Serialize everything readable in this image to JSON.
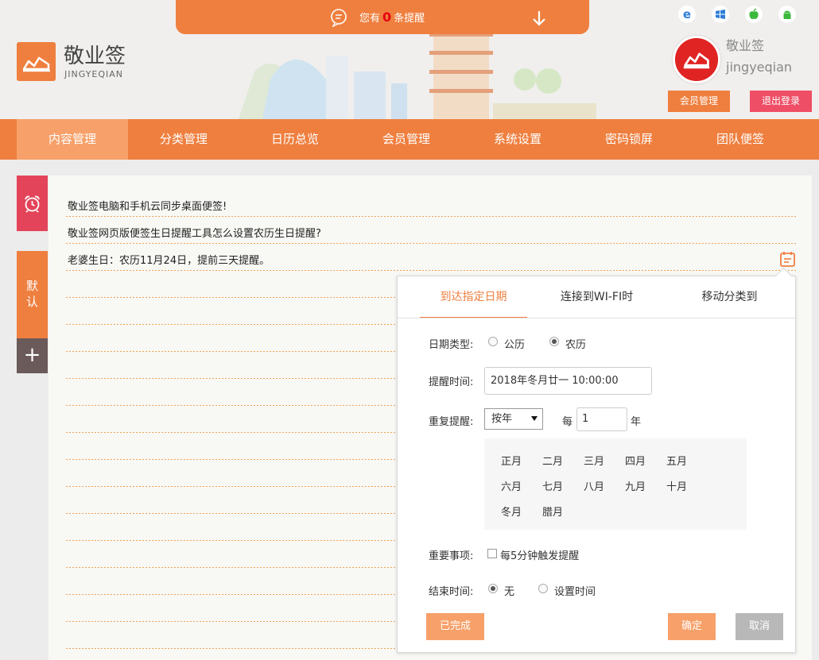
{
  "notification": {
    "prefix": "您有",
    "count": "0",
    "suffix": "条提醒"
  },
  "brand": {
    "name": "敬业签",
    "sub": "JINGYEQIAN"
  },
  "os_icons": [
    "ie-icon",
    "windows-icon",
    "apple-icon",
    "android-icon"
  ],
  "user": {
    "name": "敬业签",
    "id": "jingyeqian"
  },
  "buttons": {
    "member": "会员管理",
    "logout": "退出登录"
  },
  "nav": [
    "内容管理",
    "分类管理",
    "日历总览",
    "会员管理",
    "系统设置",
    "密码锁屏",
    "团队便签"
  ],
  "sidebar": {
    "default_label_1": "默",
    "default_label_2": "认",
    "add": "+"
  },
  "notes": [
    "敬业签电脑和手机云同步桌面便签!",
    "敬业签网页版便签生日提醒工具怎么设置农历生日提醒?",
    "老婆生日：农历11月24日，提前三天提醒。"
  ],
  "popup": {
    "tabs": [
      "到达指定日期",
      "连接到WI-FI时",
      "移动分类到"
    ],
    "date_type_label": "日期类型:",
    "date_type_options": [
      "公历",
      "农历"
    ],
    "date_type_selected": "农历",
    "remind_time_label": "提醒时间:",
    "remind_time_value": "2018年冬月廿一 10:00:00",
    "repeat_label": "重复提醒:",
    "repeat_value": "按年",
    "every_label": "每",
    "every_value": "1",
    "every_unit": "年",
    "months": [
      "正月",
      "二月",
      "三月",
      "四月",
      "五月",
      "六月",
      "七月",
      "八月",
      "九月",
      "十月",
      "冬月",
      "腊月"
    ],
    "important_label": "重要事项:",
    "important_option": "每5分钟触发提醒",
    "end_label": "结束时间:",
    "end_options": [
      "无",
      "设置时间"
    ],
    "end_selected": "无",
    "done_button": "已完成",
    "confirm_button": "确定",
    "cancel_button": "取消"
  },
  "colors": {
    "accent": "#ef7f3f",
    "nav_active": "#f7a069",
    "danger": "#ef4f66",
    "clock": "#e3445a",
    "add": "#6b5a5a"
  }
}
